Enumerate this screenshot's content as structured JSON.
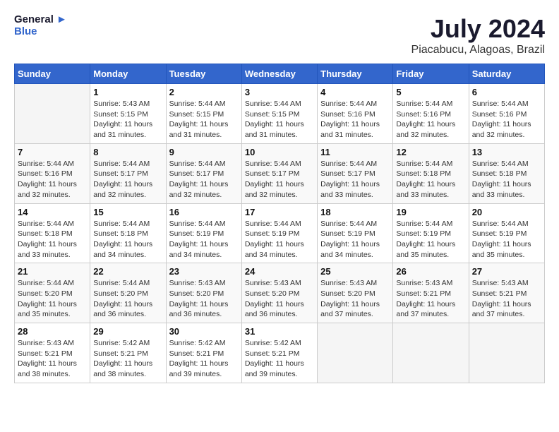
{
  "logo": {
    "line1": "General",
    "line2": "Blue"
  },
  "title": "July 2024",
  "subtitle": "Piacabucu, Alagoas, Brazil",
  "header": {
    "days": [
      "Sunday",
      "Monday",
      "Tuesday",
      "Wednesday",
      "Thursday",
      "Friday",
      "Saturday"
    ]
  },
  "weeks": [
    [
      {
        "day": "",
        "info": ""
      },
      {
        "day": "1",
        "info": "Sunrise: 5:43 AM\nSunset: 5:15 PM\nDaylight: 11 hours\nand 31 minutes."
      },
      {
        "day": "2",
        "info": "Sunrise: 5:44 AM\nSunset: 5:15 PM\nDaylight: 11 hours\nand 31 minutes."
      },
      {
        "day": "3",
        "info": "Sunrise: 5:44 AM\nSunset: 5:15 PM\nDaylight: 11 hours\nand 31 minutes."
      },
      {
        "day": "4",
        "info": "Sunrise: 5:44 AM\nSunset: 5:16 PM\nDaylight: 11 hours\nand 31 minutes."
      },
      {
        "day": "5",
        "info": "Sunrise: 5:44 AM\nSunset: 5:16 PM\nDaylight: 11 hours\nand 32 minutes."
      },
      {
        "day": "6",
        "info": "Sunrise: 5:44 AM\nSunset: 5:16 PM\nDaylight: 11 hours\nand 32 minutes."
      }
    ],
    [
      {
        "day": "7",
        "info": "Sunrise: 5:44 AM\nSunset: 5:16 PM\nDaylight: 11 hours\nand 32 minutes."
      },
      {
        "day": "8",
        "info": "Sunrise: 5:44 AM\nSunset: 5:17 PM\nDaylight: 11 hours\nand 32 minutes."
      },
      {
        "day": "9",
        "info": "Sunrise: 5:44 AM\nSunset: 5:17 PM\nDaylight: 11 hours\nand 32 minutes."
      },
      {
        "day": "10",
        "info": "Sunrise: 5:44 AM\nSunset: 5:17 PM\nDaylight: 11 hours\nand 32 minutes."
      },
      {
        "day": "11",
        "info": "Sunrise: 5:44 AM\nSunset: 5:17 PM\nDaylight: 11 hours\nand 33 minutes."
      },
      {
        "day": "12",
        "info": "Sunrise: 5:44 AM\nSunset: 5:18 PM\nDaylight: 11 hours\nand 33 minutes."
      },
      {
        "day": "13",
        "info": "Sunrise: 5:44 AM\nSunset: 5:18 PM\nDaylight: 11 hours\nand 33 minutes."
      }
    ],
    [
      {
        "day": "14",
        "info": "Sunrise: 5:44 AM\nSunset: 5:18 PM\nDaylight: 11 hours\nand 33 minutes."
      },
      {
        "day": "15",
        "info": "Sunrise: 5:44 AM\nSunset: 5:18 PM\nDaylight: 11 hours\nand 34 minutes."
      },
      {
        "day": "16",
        "info": "Sunrise: 5:44 AM\nSunset: 5:19 PM\nDaylight: 11 hours\nand 34 minutes."
      },
      {
        "day": "17",
        "info": "Sunrise: 5:44 AM\nSunset: 5:19 PM\nDaylight: 11 hours\nand 34 minutes."
      },
      {
        "day": "18",
        "info": "Sunrise: 5:44 AM\nSunset: 5:19 PM\nDaylight: 11 hours\nand 34 minutes."
      },
      {
        "day": "19",
        "info": "Sunrise: 5:44 AM\nSunset: 5:19 PM\nDaylight: 11 hours\nand 35 minutes."
      },
      {
        "day": "20",
        "info": "Sunrise: 5:44 AM\nSunset: 5:19 PM\nDaylight: 11 hours\nand 35 minutes."
      }
    ],
    [
      {
        "day": "21",
        "info": "Sunrise: 5:44 AM\nSunset: 5:20 PM\nDaylight: 11 hours\nand 35 minutes."
      },
      {
        "day": "22",
        "info": "Sunrise: 5:44 AM\nSunset: 5:20 PM\nDaylight: 11 hours\nand 36 minutes."
      },
      {
        "day": "23",
        "info": "Sunrise: 5:43 AM\nSunset: 5:20 PM\nDaylight: 11 hours\nand 36 minutes."
      },
      {
        "day": "24",
        "info": "Sunrise: 5:43 AM\nSunset: 5:20 PM\nDaylight: 11 hours\nand 36 minutes."
      },
      {
        "day": "25",
        "info": "Sunrise: 5:43 AM\nSunset: 5:20 PM\nDaylight: 11 hours\nand 37 minutes."
      },
      {
        "day": "26",
        "info": "Sunrise: 5:43 AM\nSunset: 5:21 PM\nDaylight: 11 hours\nand 37 minutes."
      },
      {
        "day": "27",
        "info": "Sunrise: 5:43 AM\nSunset: 5:21 PM\nDaylight: 11 hours\nand 37 minutes."
      }
    ],
    [
      {
        "day": "28",
        "info": "Sunrise: 5:43 AM\nSunset: 5:21 PM\nDaylight: 11 hours\nand 38 minutes."
      },
      {
        "day": "29",
        "info": "Sunrise: 5:42 AM\nSunset: 5:21 PM\nDaylight: 11 hours\nand 38 minutes."
      },
      {
        "day": "30",
        "info": "Sunrise: 5:42 AM\nSunset: 5:21 PM\nDaylight: 11 hours\nand 39 minutes."
      },
      {
        "day": "31",
        "info": "Sunrise: 5:42 AM\nSunset: 5:21 PM\nDaylight: 11 hours\nand 39 minutes."
      },
      {
        "day": "",
        "info": ""
      },
      {
        "day": "",
        "info": ""
      },
      {
        "day": "",
        "info": ""
      }
    ]
  ]
}
